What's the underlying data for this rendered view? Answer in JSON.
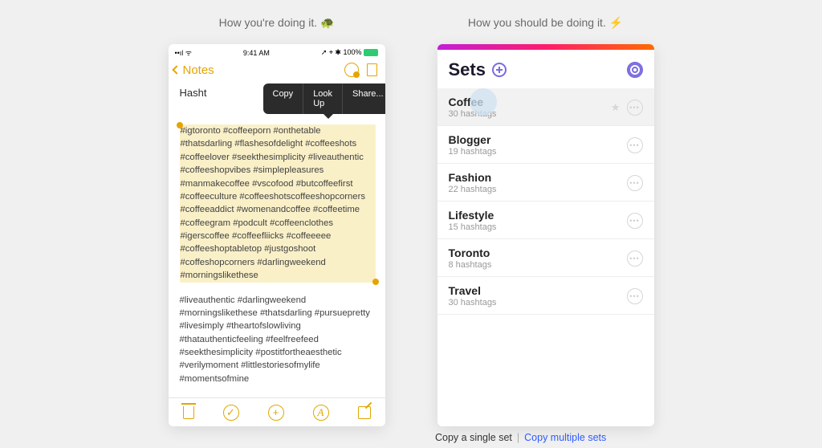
{
  "captions": {
    "left": "How you're doing it. 🐢",
    "right": "How you should be doing it. ⚡"
  },
  "notes": {
    "statusbar": {
      "signal": "••ıl ᯤ",
      "time": "9:41 AM",
      "right": "➚ ⌖ ✱ 100%"
    },
    "back_label": "Notes",
    "title": "Hasht",
    "popover": {
      "copy": "Copy",
      "lookup": "Look Up",
      "share": "Share..."
    },
    "highlighted_text": "#igtoronto #coffeeporn #onthetable #thatsdarling #flashesofdelight #coffeeshots #coffeelover #seekthesimplicity #liveauthentic #coffeeshopvibes #simplepleasures #manmakecoffee #vscofood #butcoffeefirst #coffeeculture #coffeeshotscoffeeshopcorners #coffeeaddict #womenandcoffee #coffeetime #coffeegram #podcult #coffeenclothes #igerscoffee #coffeefliicks #coffeeeee #coffeeshoptabletop #justgoshoot #coffeshopcorners #darlingweekend #morningslikethese",
    "second_paragraph": "#liveauthentic #darlingweekend #morningslikethese #thatsdarling #pursuepretty #livesimply #theartofslowliving #thatauthenticfeeling #feelfreefeed #seekthesimplicity #postitfortheaesthetic #verilymoment #littlestoriesofmylife #momentsofmine"
  },
  "sets": {
    "title": "Sets",
    "items": [
      {
        "name": "Coffee",
        "count": "30 hashtags",
        "selected": true,
        "starred": true
      },
      {
        "name": "Blogger",
        "count": "19 hashtags",
        "selected": false,
        "starred": false
      },
      {
        "name": "Fashion",
        "count": "22 hashtags",
        "selected": false,
        "starred": false
      },
      {
        "name": "Lifestyle",
        "count": "15 hashtags",
        "selected": false,
        "starred": false
      },
      {
        "name": "Toronto",
        "count": "8 hashtags",
        "selected": false,
        "starred": false
      },
      {
        "name": "Travel",
        "count": "30 hashtags",
        "selected": false,
        "starred": false
      }
    ]
  },
  "footer": {
    "single": "Copy a single set",
    "sep": "|",
    "multi": "Copy multiple sets"
  }
}
